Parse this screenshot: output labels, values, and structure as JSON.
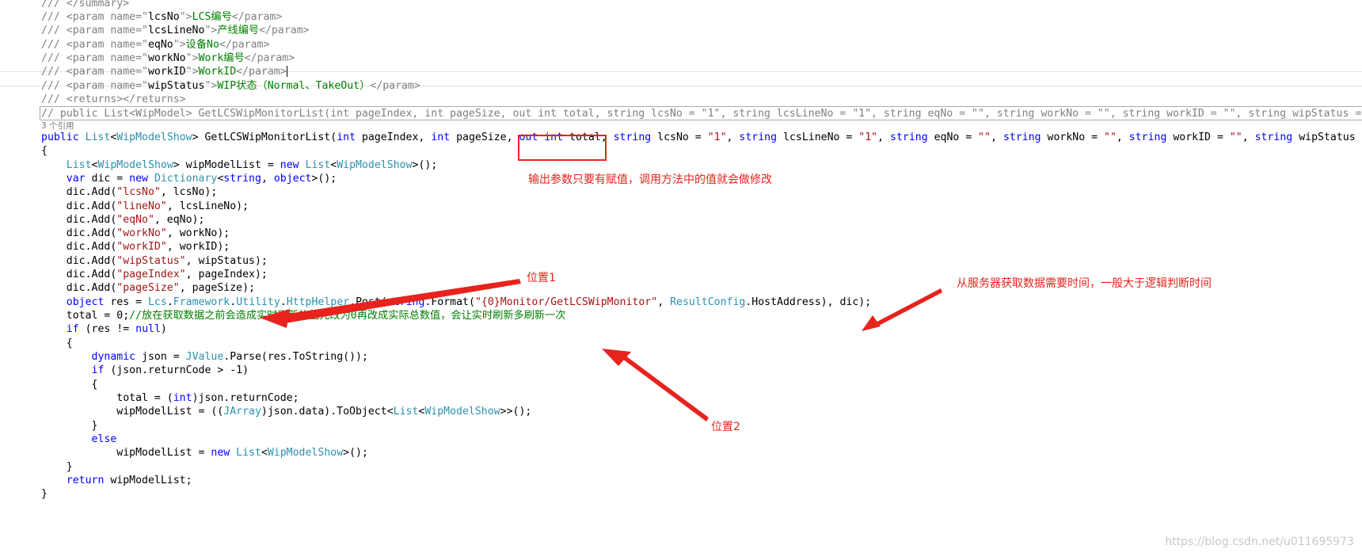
{
  "code": {
    "l0": [
      [
        "xd",
        "/// </summary>"
      ]
    ],
    "l1": [
      [
        "xd",
        "/// <param name=\""
      ],
      [
        "cl",
        "lcsNo"
      ],
      [
        "xd",
        "\">"
      ],
      [
        "cm",
        "LCS编号"
      ],
      [
        "xd",
        "</param>"
      ]
    ],
    "l2": [
      [
        "xd",
        "/// <param name=\""
      ],
      [
        "cl",
        "lcsLineNo"
      ],
      [
        "xd",
        "\">"
      ],
      [
        "cm",
        "产线编号"
      ],
      [
        "xd",
        "</param>"
      ]
    ],
    "l3": [
      [
        "xd",
        "/// <param name=\""
      ],
      [
        "cl",
        "eqNo"
      ],
      [
        "xd",
        "\">"
      ],
      [
        "cm",
        "设备No"
      ],
      [
        "xd",
        "</param>"
      ]
    ],
    "l4": [
      [
        "xd",
        "/// <param name=\""
      ],
      [
        "cl",
        "workNo"
      ],
      [
        "xd",
        "\">"
      ],
      [
        "cm",
        "Work编号"
      ],
      [
        "xd",
        "</param>"
      ]
    ],
    "l5": [
      [
        "xd",
        "/// <param name=\""
      ],
      [
        "cl",
        "workID"
      ],
      [
        "xd",
        "\">"
      ],
      [
        "cm",
        "WorkID"
      ],
      [
        "xd",
        "</param>"
      ]
    ],
    "l6": [
      [
        "xd",
        "/// <param name=\""
      ],
      [
        "cl",
        "wipStatus"
      ],
      [
        "xd",
        "\">"
      ],
      [
        "cm",
        "WIP状态（Normal、TakeOut）"
      ],
      [
        "xd",
        "</param>"
      ]
    ],
    "l7": [
      [
        "xd",
        "/// <returns></returns>"
      ]
    ],
    "l8": [
      [
        "xd",
        "// public List<WipModel> GetLCSWipMonitorList(int pageIndex, int pageSize, out int total, string lcsNo = \"1\", string lcsLineNo = \"1\", string eqNo = \"\", string workNo = \"\", string workID = \"\", string wipStatus = \"\")"
      ]
    ],
    "codelens": "3 个引用",
    "l9": [
      [
        "kw",
        "public "
      ],
      [
        "ty",
        "List"
      ],
      [
        "cl",
        "<"
      ],
      [
        "ty",
        "WipModelShow"
      ],
      [
        "cl",
        "> GetLCSWipMonitorList("
      ],
      [
        "kw",
        "int"
      ],
      [
        "cl",
        " pageIndex, "
      ],
      [
        "kw",
        "int"
      ],
      [
        "cl",
        " pageSize, "
      ],
      [
        "kw",
        "out int"
      ],
      [
        "cl",
        " total, "
      ],
      [
        "kw",
        "string"
      ],
      [
        "cl",
        " lcsNo = "
      ],
      [
        "str",
        "\"1\""
      ],
      [
        "cl",
        ", "
      ],
      [
        "kw",
        "string"
      ],
      [
        "cl",
        " lcsLineNo = "
      ],
      [
        "str",
        "\"1\""
      ],
      [
        "cl",
        ", "
      ],
      [
        "kw",
        "string"
      ],
      [
        "cl",
        " eqNo = "
      ],
      [
        "str",
        "\"\""
      ],
      [
        "cl",
        ", "
      ],
      [
        "kw",
        "string"
      ],
      [
        "cl",
        " workNo = "
      ],
      [
        "str",
        "\"\""
      ],
      [
        "cl",
        ", "
      ],
      [
        "kw",
        "string"
      ],
      [
        "cl",
        " workID = "
      ],
      [
        "str",
        "\"\""
      ],
      [
        "cl",
        ", "
      ],
      [
        "kw",
        "string"
      ],
      [
        "cl",
        " wipStatus = "
      ],
      [
        "str",
        "\"\""
      ],
      [
        "cl",
        ")"
      ]
    ],
    "l10": [
      [
        "cl",
        "{"
      ]
    ],
    "l11": [
      [
        "cl",
        "    "
      ],
      [
        "ty",
        "List"
      ],
      [
        "cl",
        "<"
      ],
      [
        "ty",
        "WipModelShow"
      ],
      [
        "cl",
        "> wipModelList = "
      ],
      [
        "kw",
        "new "
      ],
      [
        "ty",
        "List"
      ],
      [
        "cl",
        "<"
      ],
      [
        "ty",
        "WipModelShow"
      ],
      [
        "cl",
        ">();"
      ]
    ],
    "l12": [
      [
        "cl",
        "    "
      ],
      [
        "kw",
        "var"
      ],
      [
        "cl",
        " dic = "
      ],
      [
        "kw",
        "new "
      ],
      [
        "ty",
        "Dictionary"
      ],
      [
        "cl",
        "<"
      ],
      [
        "kw",
        "string"
      ],
      [
        "cl",
        ", "
      ],
      [
        "kw",
        "object"
      ],
      [
        "cl",
        ">();"
      ]
    ],
    "l13": [
      [
        "cl",
        "    dic.Add("
      ],
      [
        "str",
        "\"lcsNo\""
      ],
      [
        "cl",
        ", lcsNo);"
      ]
    ],
    "l14": [
      [
        "cl",
        "    dic.Add("
      ],
      [
        "str",
        "\"lineNo\""
      ],
      [
        "cl",
        ", lcsLineNo);"
      ]
    ],
    "l15": [
      [
        "cl",
        "    dic.Add("
      ],
      [
        "str",
        "\"eqNo\""
      ],
      [
        "cl",
        ", eqNo);"
      ]
    ],
    "l16": [
      [
        "cl",
        "    dic.Add("
      ],
      [
        "str",
        "\"workNo\""
      ],
      [
        "cl",
        ", workNo);"
      ]
    ],
    "l17": [
      [
        "cl",
        "    dic.Add("
      ],
      [
        "str",
        "\"workID\""
      ],
      [
        "cl",
        ", workID);"
      ]
    ],
    "l18": [
      [
        "cl",
        "    dic.Add("
      ],
      [
        "str",
        "\"wipStatus\""
      ],
      [
        "cl",
        ", wipStatus);"
      ]
    ],
    "l19": [
      [
        "cl",
        "    dic.Add("
      ],
      [
        "str",
        "\"pageIndex\""
      ],
      [
        "cl",
        ", pageIndex);"
      ]
    ],
    "l20": [
      [
        "cl",
        "    dic.Add("
      ],
      [
        "str",
        "\"pageSize\""
      ],
      [
        "cl",
        ", pageSize);"
      ]
    ],
    "l21": [
      [
        "cl",
        "    "
      ],
      [
        "kw",
        "object"
      ],
      [
        "cl",
        " res = "
      ],
      [
        "ty",
        "Lcs"
      ],
      [
        "cl",
        "."
      ],
      [
        "ty",
        "Framework"
      ],
      [
        "cl",
        "."
      ],
      [
        "ty",
        "Utility"
      ],
      [
        "cl",
        "."
      ],
      [
        "ty",
        "HttpHelper"
      ],
      [
        "cl",
        ".Post("
      ],
      [
        "kw",
        "string"
      ],
      [
        "cl",
        ".Format("
      ],
      [
        "str",
        "\"{0}Monitor/GetLCSWipMonitor\""
      ],
      [
        "cl",
        ", "
      ],
      [
        "ty",
        "ResultConfig"
      ],
      [
        "cl",
        ".HostAddress), dic);"
      ]
    ],
    "l22": [
      [
        "cl",
        "    total = 0;"
      ],
      [
        "cm",
        "//放在获取数据之前会造成实时刷新的值先改为0再改成实际总数值，会让实时刷新多刷新一次"
      ]
    ],
    "l23": [
      [
        "cl",
        "    "
      ],
      [
        "kw",
        "if"
      ],
      [
        "cl",
        " (res != "
      ],
      [
        "kw",
        "null"
      ],
      [
        "cl",
        ")"
      ]
    ],
    "l24": [
      [
        "cl",
        "    {"
      ]
    ],
    "l25": [
      [
        "cl",
        "        "
      ],
      [
        "kw",
        "dynamic"
      ],
      [
        "cl",
        " json = "
      ],
      [
        "ty",
        "JValue"
      ],
      [
        "cl",
        ".Parse(res.ToString());"
      ]
    ],
    "l26": [
      [
        "cl",
        "        "
      ],
      [
        "kw",
        "if"
      ],
      [
        "cl",
        " (json.returnCode > -1)"
      ]
    ],
    "l27": [
      [
        "cl",
        "        {"
      ]
    ],
    "l28": [
      [
        "cl",
        "            total = ("
      ],
      [
        "kw",
        "int"
      ],
      [
        "cl",
        ")json.returnCode;"
      ]
    ],
    "l29": [
      [
        "cl",
        "            wipModelList = (("
      ],
      [
        "ty",
        "JArray"
      ],
      [
        "cl",
        ")json.data).ToObject<"
      ],
      [
        "ty",
        "List"
      ],
      [
        "cl",
        "<"
      ],
      [
        "ty",
        "WipModelShow"
      ],
      [
        "cl",
        ">>();"
      ]
    ],
    "l30": [
      [
        "cl",
        "        }"
      ]
    ],
    "l31": [
      [
        "cl",
        "        "
      ],
      [
        "kw",
        "else"
      ]
    ],
    "l32": [
      [
        "cl",
        "            wipModelList = "
      ],
      [
        "kw",
        "new "
      ],
      [
        "ty",
        "List"
      ],
      [
        "cl",
        "<"
      ],
      [
        "ty",
        "WipModelShow"
      ],
      [
        "cl",
        ">();"
      ]
    ],
    "l33": [
      [
        "cl",
        "    }"
      ]
    ],
    "l34": [
      [
        "cl",
        "    "
      ],
      [
        "kw",
        "return"
      ],
      [
        "cl",
        " wipModelList;"
      ]
    ],
    "l35": [
      [
        "cl",
        "}"
      ]
    ]
  },
  "annotations": {
    "out_note": "输出参数只要有赋值，调用方法中的值就会做修改",
    "pos1": "位置1",
    "server_note": "从服务器获取数据需要时间，一般大于逻辑判断时间",
    "pos2": "位置2"
  },
  "colors": {
    "keyword": "#0000ff",
    "type": "#2b91af",
    "string": "#a31515",
    "comment": "#008000",
    "xmldoc": "#808080",
    "annotation": "#e8221c"
  },
  "watermark": "https://blog.csdn.net/u011695973"
}
